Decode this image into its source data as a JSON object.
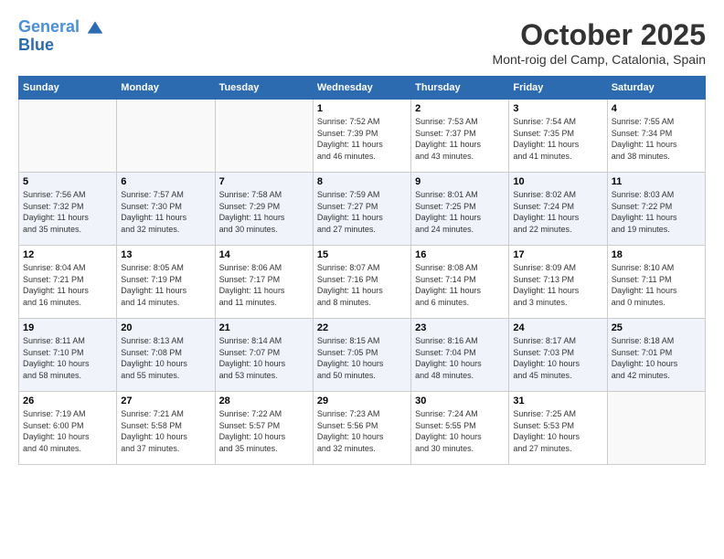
{
  "header": {
    "logo_line1": "General",
    "logo_line2": "Blue",
    "month": "October 2025",
    "location": "Mont-roig del Camp, Catalonia, Spain"
  },
  "days_of_week": [
    "Sunday",
    "Monday",
    "Tuesday",
    "Wednesday",
    "Thursday",
    "Friday",
    "Saturday"
  ],
  "weeks": [
    [
      {
        "day": "",
        "info": ""
      },
      {
        "day": "",
        "info": ""
      },
      {
        "day": "",
        "info": ""
      },
      {
        "day": "1",
        "info": "Sunrise: 7:52 AM\nSunset: 7:39 PM\nDaylight: 11 hours\nand 46 minutes."
      },
      {
        "day": "2",
        "info": "Sunrise: 7:53 AM\nSunset: 7:37 PM\nDaylight: 11 hours\nand 43 minutes."
      },
      {
        "day": "3",
        "info": "Sunrise: 7:54 AM\nSunset: 7:35 PM\nDaylight: 11 hours\nand 41 minutes."
      },
      {
        "day": "4",
        "info": "Sunrise: 7:55 AM\nSunset: 7:34 PM\nDaylight: 11 hours\nand 38 minutes."
      }
    ],
    [
      {
        "day": "5",
        "info": "Sunrise: 7:56 AM\nSunset: 7:32 PM\nDaylight: 11 hours\nand 35 minutes."
      },
      {
        "day": "6",
        "info": "Sunrise: 7:57 AM\nSunset: 7:30 PM\nDaylight: 11 hours\nand 32 minutes."
      },
      {
        "day": "7",
        "info": "Sunrise: 7:58 AM\nSunset: 7:29 PM\nDaylight: 11 hours\nand 30 minutes."
      },
      {
        "day": "8",
        "info": "Sunrise: 7:59 AM\nSunset: 7:27 PM\nDaylight: 11 hours\nand 27 minutes."
      },
      {
        "day": "9",
        "info": "Sunrise: 8:01 AM\nSunset: 7:25 PM\nDaylight: 11 hours\nand 24 minutes."
      },
      {
        "day": "10",
        "info": "Sunrise: 8:02 AM\nSunset: 7:24 PM\nDaylight: 11 hours\nand 22 minutes."
      },
      {
        "day": "11",
        "info": "Sunrise: 8:03 AM\nSunset: 7:22 PM\nDaylight: 11 hours\nand 19 minutes."
      }
    ],
    [
      {
        "day": "12",
        "info": "Sunrise: 8:04 AM\nSunset: 7:21 PM\nDaylight: 11 hours\nand 16 minutes."
      },
      {
        "day": "13",
        "info": "Sunrise: 8:05 AM\nSunset: 7:19 PM\nDaylight: 11 hours\nand 14 minutes."
      },
      {
        "day": "14",
        "info": "Sunrise: 8:06 AM\nSunset: 7:17 PM\nDaylight: 11 hours\nand 11 minutes."
      },
      {
        "day": "15",
        "info": "Sunrise: 8:07 AM\nSunset: 7:16 PM\nDaylight: 11 hours\nand 8 minutes."
      },
      {
        "day": "16",
        "info": "Sunrise: 8:08 AM\nSunset: 7:14 PM\nDaylight: 11 hours\nand 6 minutes."
      },
      {
        "day": "17",
        "info": "Sunrise: 8:09 AM\nSunset: 7:13 PM\nDaylight: 11 hours\nand 3 minutes."
      },
      {
        "day": "18",
        "info": "Sunrise: 8:10 AM\nSunset: 7:11 PM\nDaylight: 11 hours\nand 0 minutes."
      }
    ],
    [
      {
        "day": "19",
        "info": "Sunrise: 8:11 AM\nSunset: 7:10 PM\nDaylight: 10 hours\nand 58 minutes."
      },
      {
        "day": "20",
        "info": "Sunrise: 8:13 AM\nSunset: 7:08 PM\nDaylight: 10 hours\nand 55 minutes."
      },
      {
        "day": "21",
        "info": "Sunrise: 8:14 AM\nSunset: 7:07 PM\nDaylight: 10 hours\nand 53 minutes."
      },
      {
        "day": "22",
        "info": "Sunrise: 8:15 AM\nSunset: 7:05 PM\nDaylight: 10 hours\nand 50 minutes."
      },
      {
        "day": "23",
        "info": "Sunrise: 8:16 AM\nSunset: 7:04 PM\nDaylight: 10 hours\nand 48 minutes."
      },
      {
        "day": "24",
        "info": "Sunrise: 8:17 AM\nSunset: 7:03 PM\nDaylight: 10 hours\nand 45 minutes."
      },
      {
        "day": "25",
        "info": "Sunrise: 8:18 AM\nSunset: 7:01 PM\nDaylight: 10 hours\nand 42 minutes."
      }
    ],
    [
      {
        "day": "26",
        "info": "Sunrise: 7:19 AM\nSunset: 6:00 PM\nDaylight: 10 hours\nand 40 minutes."
      },
      {
        "day": "27",
        "info": "Sunrise: 7:21 AM\nSunset: 5:58 PM\nDaylight: 10 hours\nand 37 minutes."
      },
      {
        "day": "28",
        "info": "Sunrise: 7:22 AM\nSunset: 5:57 PM\nDaylight: 10 hours\nand 35 minutes."
      },
      {
        "day": "29",
        "info": "Sunrise: 7:23 AM\nSunset: 5:56 PM\nDaylight: 10 hours\nand 32 minutes."
      },
      {
        "day": "30",
        "info": "Sunrise: 7:24 AM\nSunset: 5:55 PM\nDaylight: 10 hours\nand 30 minutes."
      },
      {
        "day": "31",
        "info": "Sunrise: 7:25 AM\nSunset: 5:53 PM\nDaylight: 10 hours\nand 27 minutes."
      },
      {
        "day": "",
        "info": ""
      }
    ]
  ]
}
